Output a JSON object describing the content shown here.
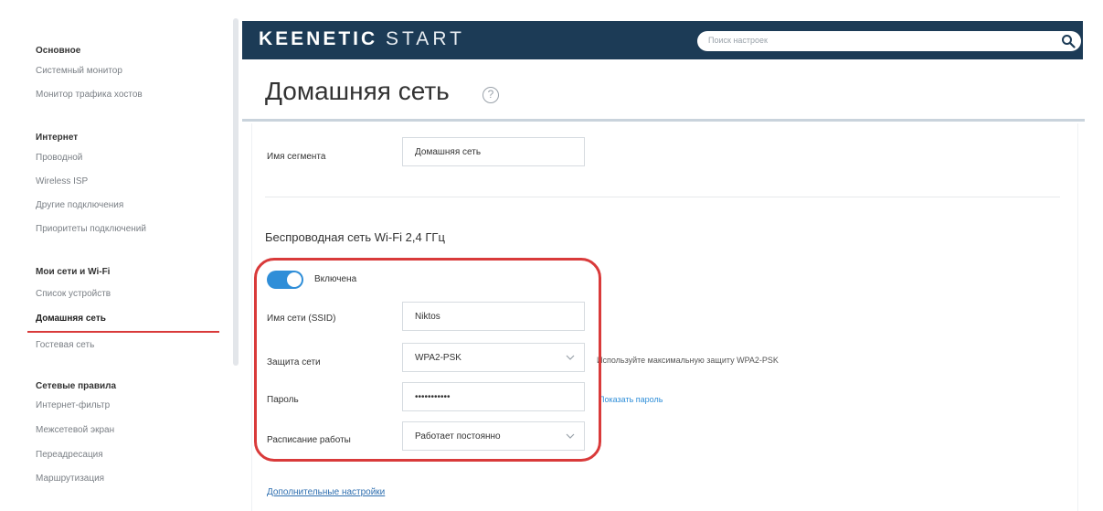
{
  "sidebar": {
    "groups": [
      {
        "title": "Основное",
        "items": [
          "Системный монитор",
          "Монитор трафика хостов"
        ]
      },
      {
        "title": "Интернет",
        "items": [
          "Проводной",
          "Wireless ISP",
          "Другие подключения",
          "Приоритеты подключений"
        ]
      },
      {
        "title": "Мои сети и Wi-Fi",
        "items": [
          "Список устройств",
          "Домашняя сеть",
          "Гостевая сеть"
        ]
      },
      {
        "title": "Сетевые правила",
        "items": [
          "Интернет-фильтр",
          "Межсетевой экран",
          "Переадресация",
          "Маршрутизация"
        ]
      }
    ],
    "active_item": "Домашняя сеть"
  },
  "header": {
    "logo_bold": "KEENETIC",
    "logo_thin": "START",
    "search_placeholder": "Поиск настроек",
    "search_icon": "search-icon"
  },
  "page": {
    "title": "Домашняя сеть",
    "help_glyph": "?"
  },
  "segment": {
    "label": "Имя сегмента",
    "value": "Домашняя сеть"
  },
  "wifi": {
    "section_title": "Беспроводная сеть Wi-Fi 2,4 ГГц",
    "enabled_label": "Включена",
    "enabled": true,
    "ssid_label": "Имя сети (SSID)",
    "ssid_value": "Niktos",
    "security_label": "Защита сети",
    "security_value": "WPA2-PSK",
    "security_hint": "Используйте максимальную защиту WPA2-PSK",
    "password_label": "Пароль",
    "password_value": "•••••••••••",
    "show_password_link": "Показать пароль",
    "schedule_label": "Расписание работы",
    "schedule_value": "Работает постоянно",
    "advanced_link": "Дополнительные настройки"
  },
  "colors": {
    "header_bg": "#1c3b56",
    "accent": "#2f8ed8",
    "highlight": "#d93a3a"
  }
}
